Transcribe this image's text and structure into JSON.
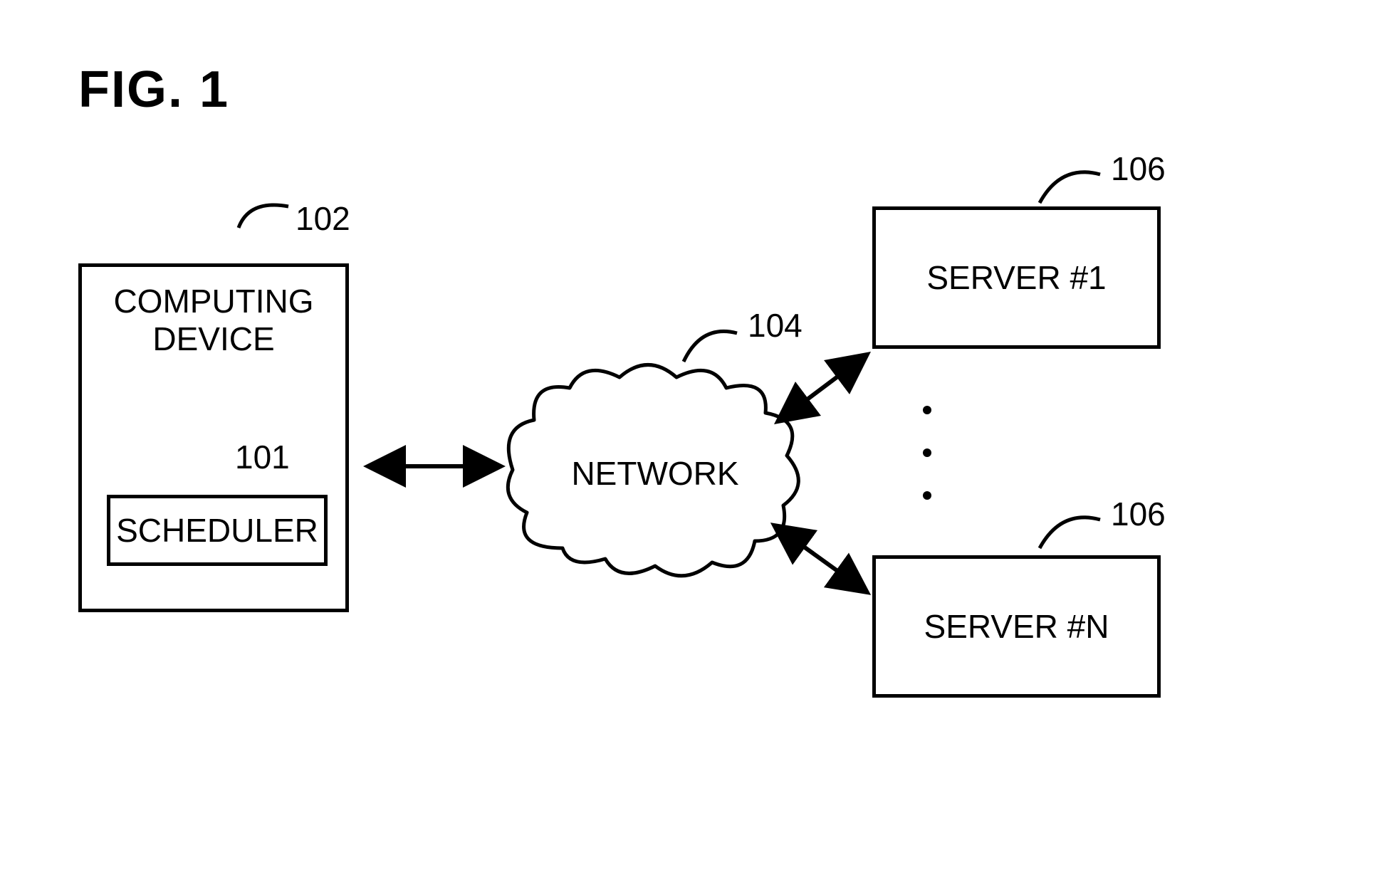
{
  "figure_title": "FIG. 1",
  "computing_device": {
    "label": "COMPUTING\nDEVICE",
    "ref": "102",
    "scheduler": {
      "label": "SCHEDULER",
      "ref": "101"
    }
  },
  "network": {
    "label": "NETWORK",
    "ref": "104"
  },
  "servers": {
    "top": {
      "label": "SERVER #1",
      "ref": "106"
    },
    "bottom": {
      "label": "SERVER #N",
      "ref": "106"
    }
  }
}
